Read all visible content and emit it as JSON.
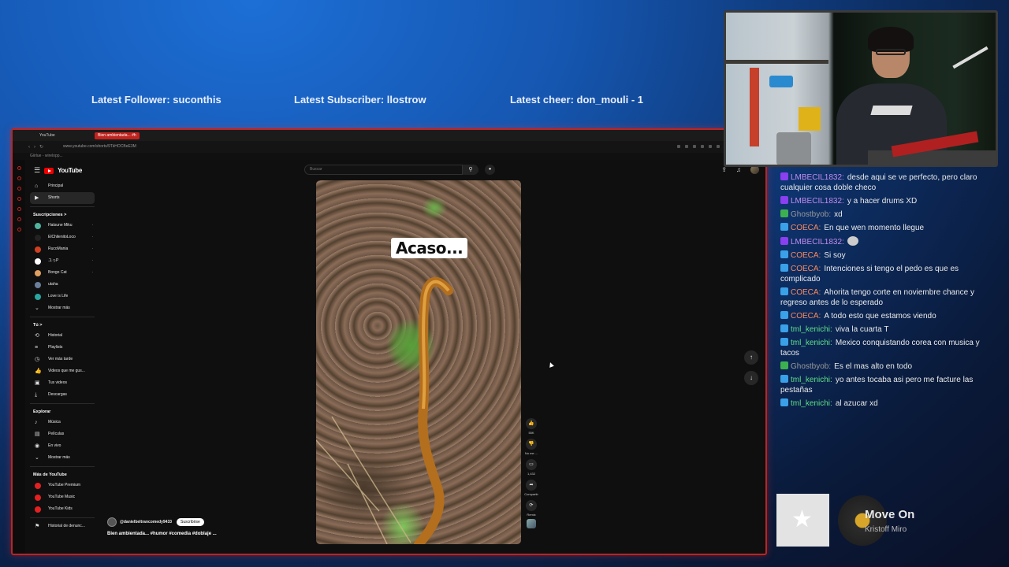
{
  "overlay": {
    "latest_follower": "Latest Follower: suconthis",
    "latest_subscriber": "Latest Subscriber: llostrow",
    "latest_cheer": "Latest cheer: don_mouli - 1"
  },
  "browser": {
    "tabs": [
      "YouTube",
      "Bien ambientada... #h"
    ],
    "url": "www.youtube.com/shorts/9TkHOCBeE3M",
    "bookmark": "Giirlue - wirelopp..."
  },
  "youtube": {
    "logo": "YouTube",
    "search_placeholder": "Buscar",
    "sidebar": {
      "main": [
        {
          "label": "Principal",
          "icon": "home-icon"
        },
        {
          "label": "Shorts",
          "icon": "shorts-icon"
        }
      ],
      "subs_header": "Suscripciones  >",
      "subscriptions": [
        {
          "label": "Hatsune Miku",
          "color": "#4fb39e"
        },
        {
          "label": "ElChilenitoLoco",
          "color": "#222222"
        },
        {
          "label": "RucoMania",
          "color": "#d04020"
        },
        {
          "label": "ユっP",
          "color": "#ffffff"
        },
        {
          "label": "Bongo Cat",
          "color": "#e0a060"
        },
        {
          "label": "utaha",
          "color": "#6a7f9a"
        },
        {
          "label": "Love is Life",
          "color": "#2aa5a0"
        }
      ],
      "subs_more": "Mostrar más",
      "you_header": "Tú  >",
      "you_items": [
        "Historial",
        "Playlists",
        "Ver más tarde",
        "Videos que me gus...",
        "Tus videos",
        "Descargas"
      ],
      "explore_header": "Explorar",
      "explore_items": [
        "Música",
        "Películas",
        "En vivo",
        "Mostrar más"
      ],
      "more_header": "Más de YouTube",
      "more_items": [
        "YouTube Premium",
        "YouTube Music",
        "YouTube Kids"
      ],
      "report": "Historial de denunc..."
    },
    "short": {
      "caption": "Acaso...",
      "likes": "55K",
      "dislike": "No me ...",
      "comments": "1,432",
      "share": "Compartir",
      "remix": "Remix",
      "channel": "@danielbeltrancomedy9433",
      "subscribe": "Suscribirse",
      "title": "Bien ambientada... #humor #comedia #doblaje ..."
    }
  },
  "chat": [
    {
      "user": "LMBECIL1832",
      "badge": "purple",
      "color": "#c48cf0",
      "text": "desde aqui se ve perfecto, pero claro cualquier cosa doble checo"
    },
    {
      "user": "LMBECIL1832",
      "badge": "purple",
      "color": "#c48cf0",
      "text": "y a hacer drums XD"
    },
    {
      "user": "Ghostbyob",
      "badge": "green",
      "color": "#9a9a9a",
      "text": "xd"
    },
    {
      "user": "COECA",
      "badge": "blue",
      "color": "#ff8a5a",
      "text": "En que wen momento llegue"
    },
    {
      "user": "LMBECIL1832",
      "badge": "purple",
      "color": "#c48cf0",
      "text": ""
    },
    {
      "user": "COECA",
      "badge": "blue",
      "color": "#ff8a5a",
      "text": "Si soy"
    },
    {
      "user": "COECA",
      "badge": "blue",
      "color": "#ff8a5a",
      "text": "Intenciones si tengo el pedo es que es complicado"
    },
    {
      "user": "COECA",
      "badge": "blue",
      "color": "#ff8a5a",
      "text": "Ahorita tengo corte en noviembre chance y regreso antes de lo esperado"
    },
    {
      "user": "COECA",
      "badge": "blue",
      "color": "#ff8a5a",
      "text": "A todo esto que estamos viendo"
    },
    {
      "user": "tml_kenichi",
      "badge": "blue",
      "color": "#5fe08a",
      "text": "viva la cuarta T"
    },
    {
      "user": "tml_kenichi",
      "badge": "blue",
      "color": "#5fe08a",
      "text": "Mexico conquistando corea con musica y tacos"
    },
    {
      "user": "Ghostbyob",
      "badge": "green",
      "color": "#9a9a9a",
      "text": "Es el mas alto en todo"
    },
    {
      "user": "tml_kenichi",
      "badge": "blue",
      "color": "#5fe08a",
      "text": "yo antes tocaba asi pero me facture las pestañas"
    },
    {
      "user": "tml_kenichi",
      "badge": "blue",
      "color": "#5fe08a",
      "text": "al azucar xd"
    }
  ],
  "now_playing": {
    "title": "Move On",
    "artist": "Kristoff Miro"
  }
}
